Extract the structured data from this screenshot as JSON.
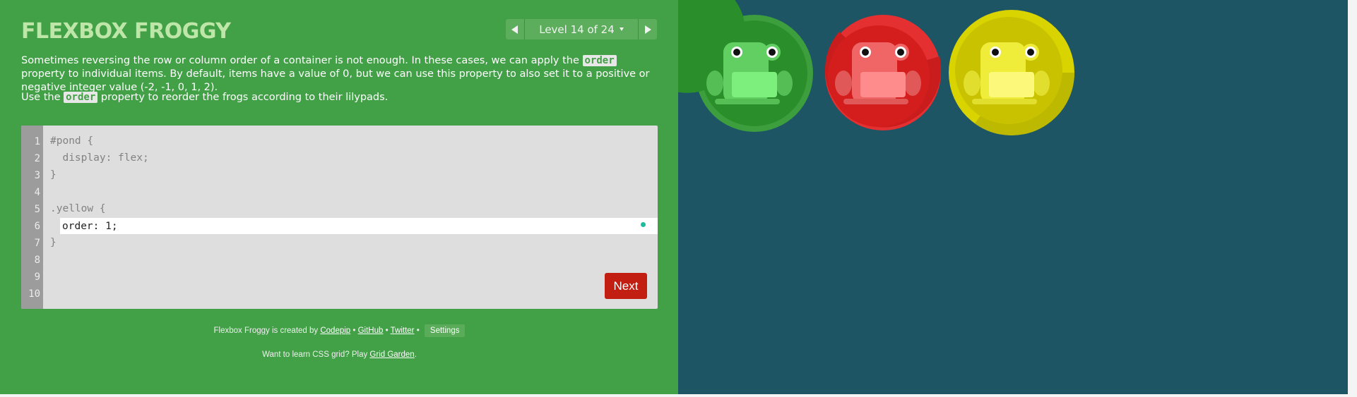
{
  "app": {
    "title": "Flexbox Froggy"
  },
  "level": {
    "indicator": "Level 14 of 24"
  },
  "instructions": {
    "p1": [
      "Sometimes reversing the row or column order of a container is not enough. In these cases, we can apply the ",
      "order",
      " property to individual items. By default, items have a value of 0, but we can use this property to also set it to a positive or negative integer value (-2, -1, 0, 1, 2)."
    ],
    "p2": [
      "Use the ",
      "order",
      " property to reorder the frogs according to their lilypads."
    ]
  },
  "editor": {
    "line_numbers": [
      "1",
      "2",
      "3",
      "4",
      "5",
      "6",
      "7",
      "8",
      "9",
      "10"
    ],
    "lines_before": [
      "#pond {",
      "  display: flex;",
      "}",
      "",
      ".yellow {"
    ],
    "input_value": "order: 1;",
    "lines_after": [
      "}"
    ],
    "next_label": "Next"
  },
  "footer": {
    "credit_prefix": "Flexbox Froggy is created by ",
    "codepip": "Codepip",
    "sep": " • ",
    "github": "GitHub",
    "twitter": "Twitter",
    "settings": "Settings",
    "grid_prefix": "Want to learn CSS grid? Play ",
    "grid_link": "Grid Garden",
    "grid_suffix": "."
  },
  "board": {
    "lilypads": [
      {
        "name": "green",
        "color": "#2a8f2a",
        "dark": "#217a21"
      },
      {
        "name": "red",
        "color": "#d41e1e",
        "dark": "#b01616"
      },
      {
        "name": "yellow",
        "color": "#c8c200",
        "dark": "#a9a400"
      }
    ],
    "frogs": [
      {
        "name": "green",
        "color": "#62cf62",
        "belly": "#7cef7c"
      },
      {
        "name": "red",
        "color": "#f06666",
        "belly": "#ff8c8c"
      },
      {
        "name": "yellow",
        "color": "#f0ec3a",
        "belly": "#fbf87a"
      }
    ]
  }
}
